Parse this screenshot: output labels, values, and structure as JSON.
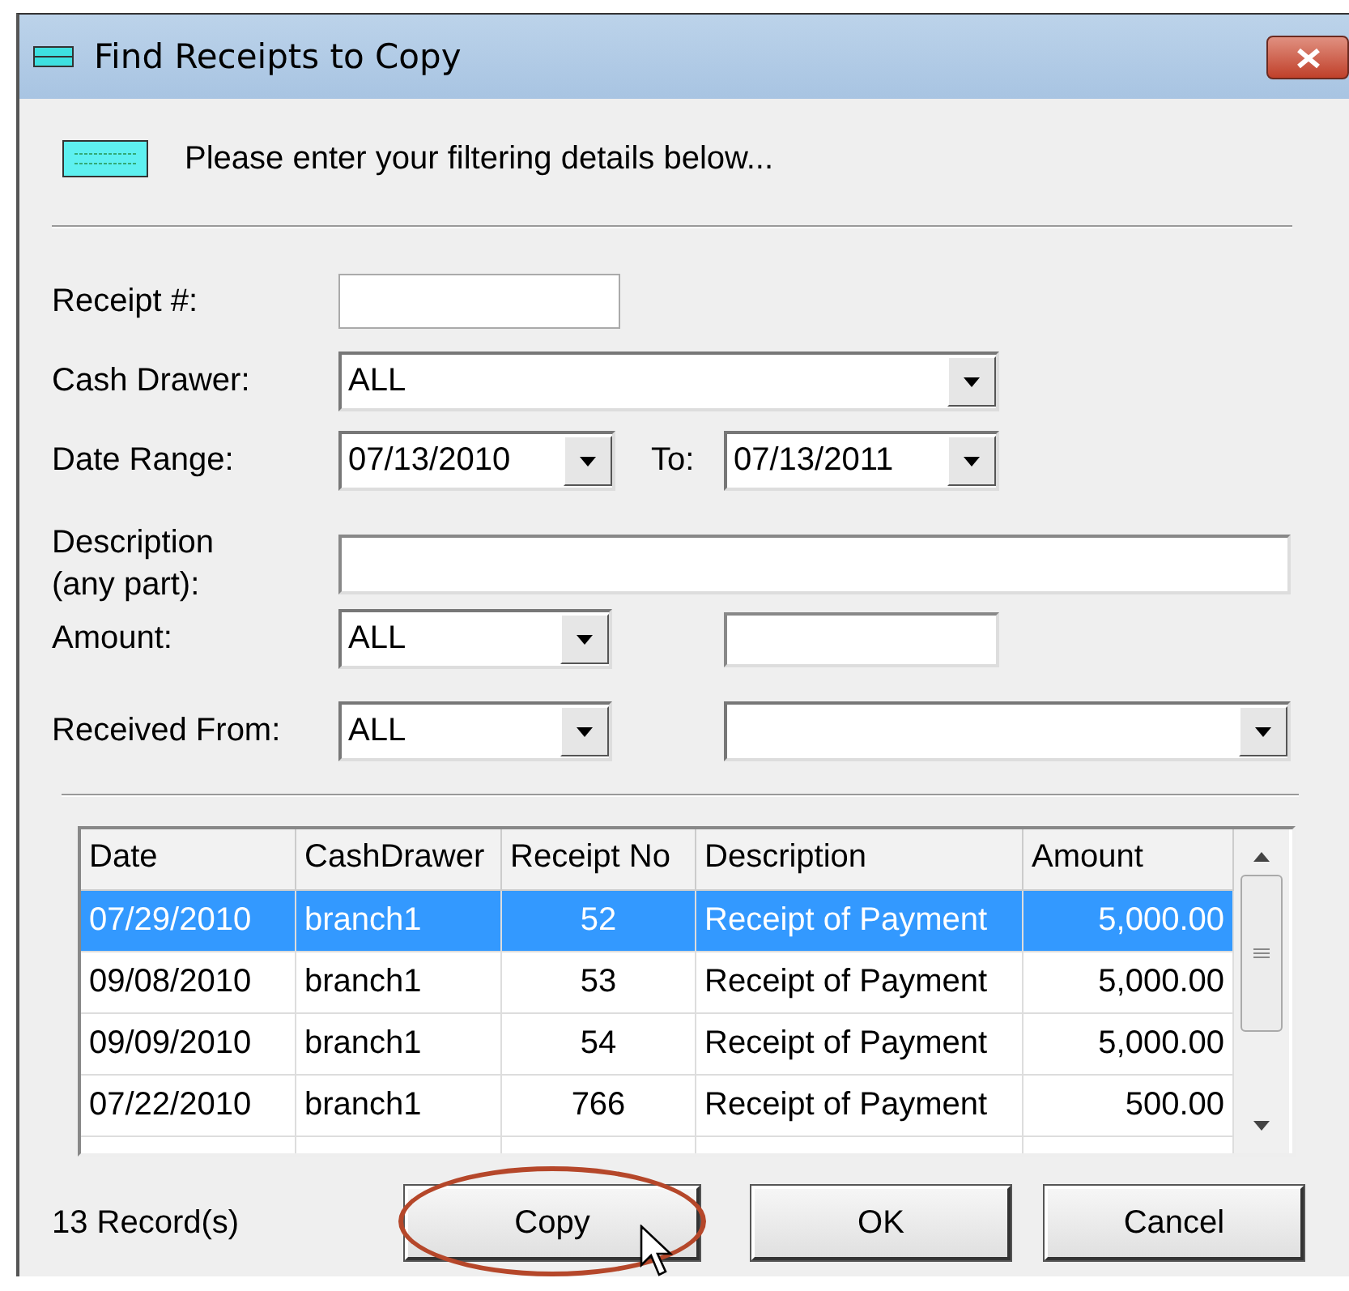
{
  "window": {
    "title": "Find Receipts to Copy"
  },
  "instruction": "Please enter your filtering details below...",
  "form": {
    "receipt_no": {
      "label": "Receipt #:"
    },
    "cash_drawer": {
      "label": "Cash Drawer:",
      "value": "ALL"
    },
    "date_range": {
      "label": "Date Range:",
      "from": "07/13/2010",
      "to_label": "To:",
      "to": "07/13/2011"
    },
    "description": {
      "label": "Description\n(any part):"
    },
    "amount": {
      "label": "Amount:",
      "operator": "ALL"
    },
    "received_from": {
      "label": "Received From:",
      "filter": "ALL"
    }
  },
  "table": {
    "columns": [
      "Date",
      "CashDrawer",
      "Receipt No",
      "Description",
      "Amount"
    ],
    "rows": [
      {
        "selected": true,
        "cells": [
          "07/29/2010",
          "branch1",
          "52",
          "Receipt of Payment",
          "5,000.00"
        ]
      },
      {
        "selected": false,
        "cells": [
          "09/08/2010",
          "branch1",
          "53",
          "Receipt of Payment",
          "5,000.00"
        ]
      },
      {
        "selected": false,
        "cells": [
          "09/09/2010",
          "branch1",
          "54",
          "Receipt of Payment",
          "5,000.00"
        ]
      },
      {
        "selected": false,
        "cells": [
          "07/22/2010",
          "branch1",
          "766",
          "Receipt of Payment",
          "500.00"
        ]
      }
    ]
  },
  "record_count": "13 Record(s)",
  "buttons": [
    {
      "label": "Copy",
      "highlighted": true
    },
    {
      "label": "OK",
      "highlighted": false
    },
    {
      "label": "Cancel",
      "highlighted": false
    }
  ]
}
